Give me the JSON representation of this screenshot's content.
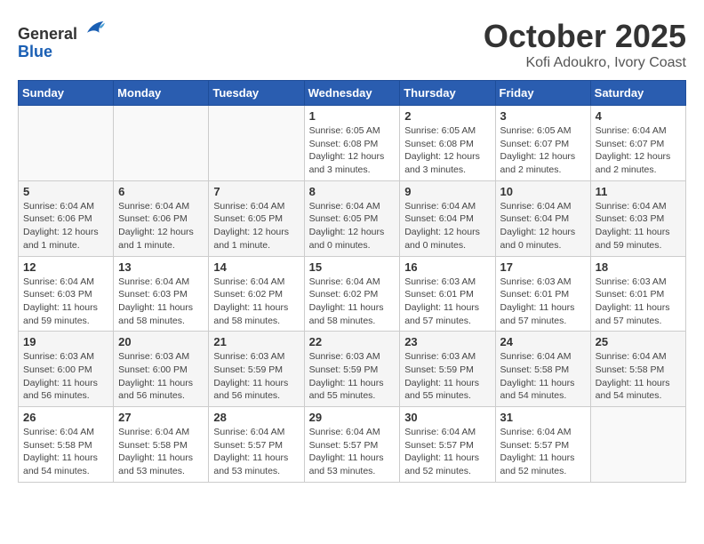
{
  "header": {
    "logo_general": "General",
    "logo_blue": "Blue",
    "month_title": "October 2025",
    "location": "Kofi Adoukro, Ivory Coast"
  },
  "days_of_week": [
    "Sunday",
    "Monday",
    "Tuesday",
    "Wednesday",
    "Thursday",
    "Friday",
    "Saturday"
  ],
  "weeks": [
    [
      {
        "day": "",
        "info": ""
      },
      {
        "day": "",
        "info": ""
      },
      {
        "day": "",
        "info": ""
      },
      {
        "day": "1",
        "info": "Sunrise: 6:05 AM\nSunset: 6:08 PM\nDaylight: 12 hours and 3 minutes."
      },
      {
        "day": "2",
        "info": "Sunrise: 6:05 AM\nSunset: 6:08 PM\nDaylight: 12 hours and 3 minutes."
      },
      {
        "day": "3",
        "info": "Sunrise: 6:05 AM\nSunset: 6:07 PM\nDaylight: 12 hours and 2 minutes."
      },
      {
        "day": "4",
        "info": "Sunrise: 6:04 AM\nSunset: 6:07 PM\nDaylight: 12 hours and 2 minutes."
      }
    ],
    [
      {
        "day": "5",
        "info": "Sunrise: 6:04 AM\nSunset: 6:06 PM\nDaylight: 12 hours and 1 minute."
      },
      {
        "day": "6",
        "info": "Sunrise: 6:04 AM\nSunset: 6:06 PM\nDaylight: 12 hours and 1 minute."
      },
      {
        "day": "7",
        "info": "Sunrise: 6:04 AM\nSunset: 6:05 PM\nDaylight: 12 hours and 1 minute."
      },
      {
        "day": "8",
        "info": "Sunrise: 6:04 AM\nSunset: 6:05 PM\nDaylight: 12 hours and 0 minutes."
      },
      {
        "day": "9",
        "info": "Sunrise: 6:04 AM\nSunset: 6:04 PM\nDaylight: 12 hours and 0 minutes."
      },
      {
        "day": "10",
        "info": "Sunrise: 6:04 AM\nSunset: 6:04 PM\nDaylight: 12 hours and 0 minutes."
      },
      {
        "day": "11",
        "info": "Sunrise: 6:04 AM\nSunset: 6:03 PM\nDaylight: 11 hours and 59 minutes."
      }
    ],
    [
      {
        "day": "12",
        "info": "Sunrise: 6:04 AM\nSunset: 6:03 PM\nDaylight: 11 hours and 59 minutes."
      },
      {
        "day": "13",
        "info": "Sunrise: 6:04 AM\nSunset: 6:03 PM\nDaylight: 11 hours and 58 minutes."
      },
      {
        "day": "14",
        "info": "Sunrise: 6:04 AM\nSunset: 6:02 PM\nDaylight: 11 hours and 58 minutes."
      },
      {
        "day": "15",
        "info": "Sunrise: 6:04 AM\nSunset: 6:02 PM\nDaylight: 11 hours and 58 minutes."
      },
      {
        "day": "16",
        "info": "Sunrise: 6:03 AM\nSunset: 6:01 PM\nDaylight: 11 hours and 57 minutes."
      },
      {
        "day": "17",
        "info": "Sunrise: 6:03 AM\nSunset: 6:01 PM\nDaylight: 11 hours and 57 minutes."
      },
      {
        "day": "18",
        "info": "Sunrise: 6:03 AM\nSunset: 6:01 PM\nDaylight: 11 hours and 57 minutes."
      }
    ],
    [
      {
        "day": "19",
        "info": "Sunrise: 6:03 AM\nSunset: 6:00 PM\nDaylight: 11 hours and 56 minutes."
      },
      {
        "day": "20",
        "info": "Sunrise: 6:03 AM\nSunset: 6:00 PM\nDaylight: 11 hours and 56 minutes."
      },
      {
        "day": "21",
        "info": "Sunrise: 6:03 AM\nSunset: 5:59 PM\nDaylight: 11 hours and 56 minutes."
      },
      {
        "day": "22",
        "info": "Sunrise: 6:03 AM\nSunset: 5:59 PM\nDaylight: 11 hours and 55 minutes."
      },
      {
        "day": "23",
        "info": "Sunrise: 6:03 AM\nSunset: 5:59 PM\nDaylight: 11 hours and 55 minutes."
      },
      {
        "day": "24",
        "info": "Sunrise: 6:04 AM\nSunset: 5:58 PM\nDaylight: 11 hours and 54 minutes."
      },
      {
        "day": "25",
        "info": "Sunrise: 6:04 AM\nSunset: 5:58 PM\nDaylight: 11 hours and 54 minutes."
      }
    ],
    [
      {
        "day": "26",
        "info": "Sunrise: 6:04 AM\nSunset: 5:58 PM\nDaylight: 11 hours and 54 minutes."
      },
      {
        "day": "27",
        "info": "Sunrise: 6:04 AM\nSunset: 5:58 PM\nDaylight: 11 hours and 53 minutes."
      },
      {
        "day": "28",
        "info": "Sunrise: 6:04 AM\nSunset: 5:57 PM\nDaylight: 11 hours and 53 minutes."
      },
      {
        "day": "29",
        "info": "Sunrise: 6:04 AM\nSunset: 5:57 PM\nDaylight: 11 hours and 53 minutes."
      },
      {
        "day": "30",
        "info": "Sunrise: 6:04 AM\nSunset: 5:57 PM\nDaylight: 11 hours and 52 minutes."
      },
      {
        "day": "31",
        "info": "Sunrise: 6:04 AM\nSunset: 5:57 PM\nDaylight: 11 hours and 52 minutes."
      },
      {
        "day": "",
        "info": ""
      }
    ]
  ]
}
